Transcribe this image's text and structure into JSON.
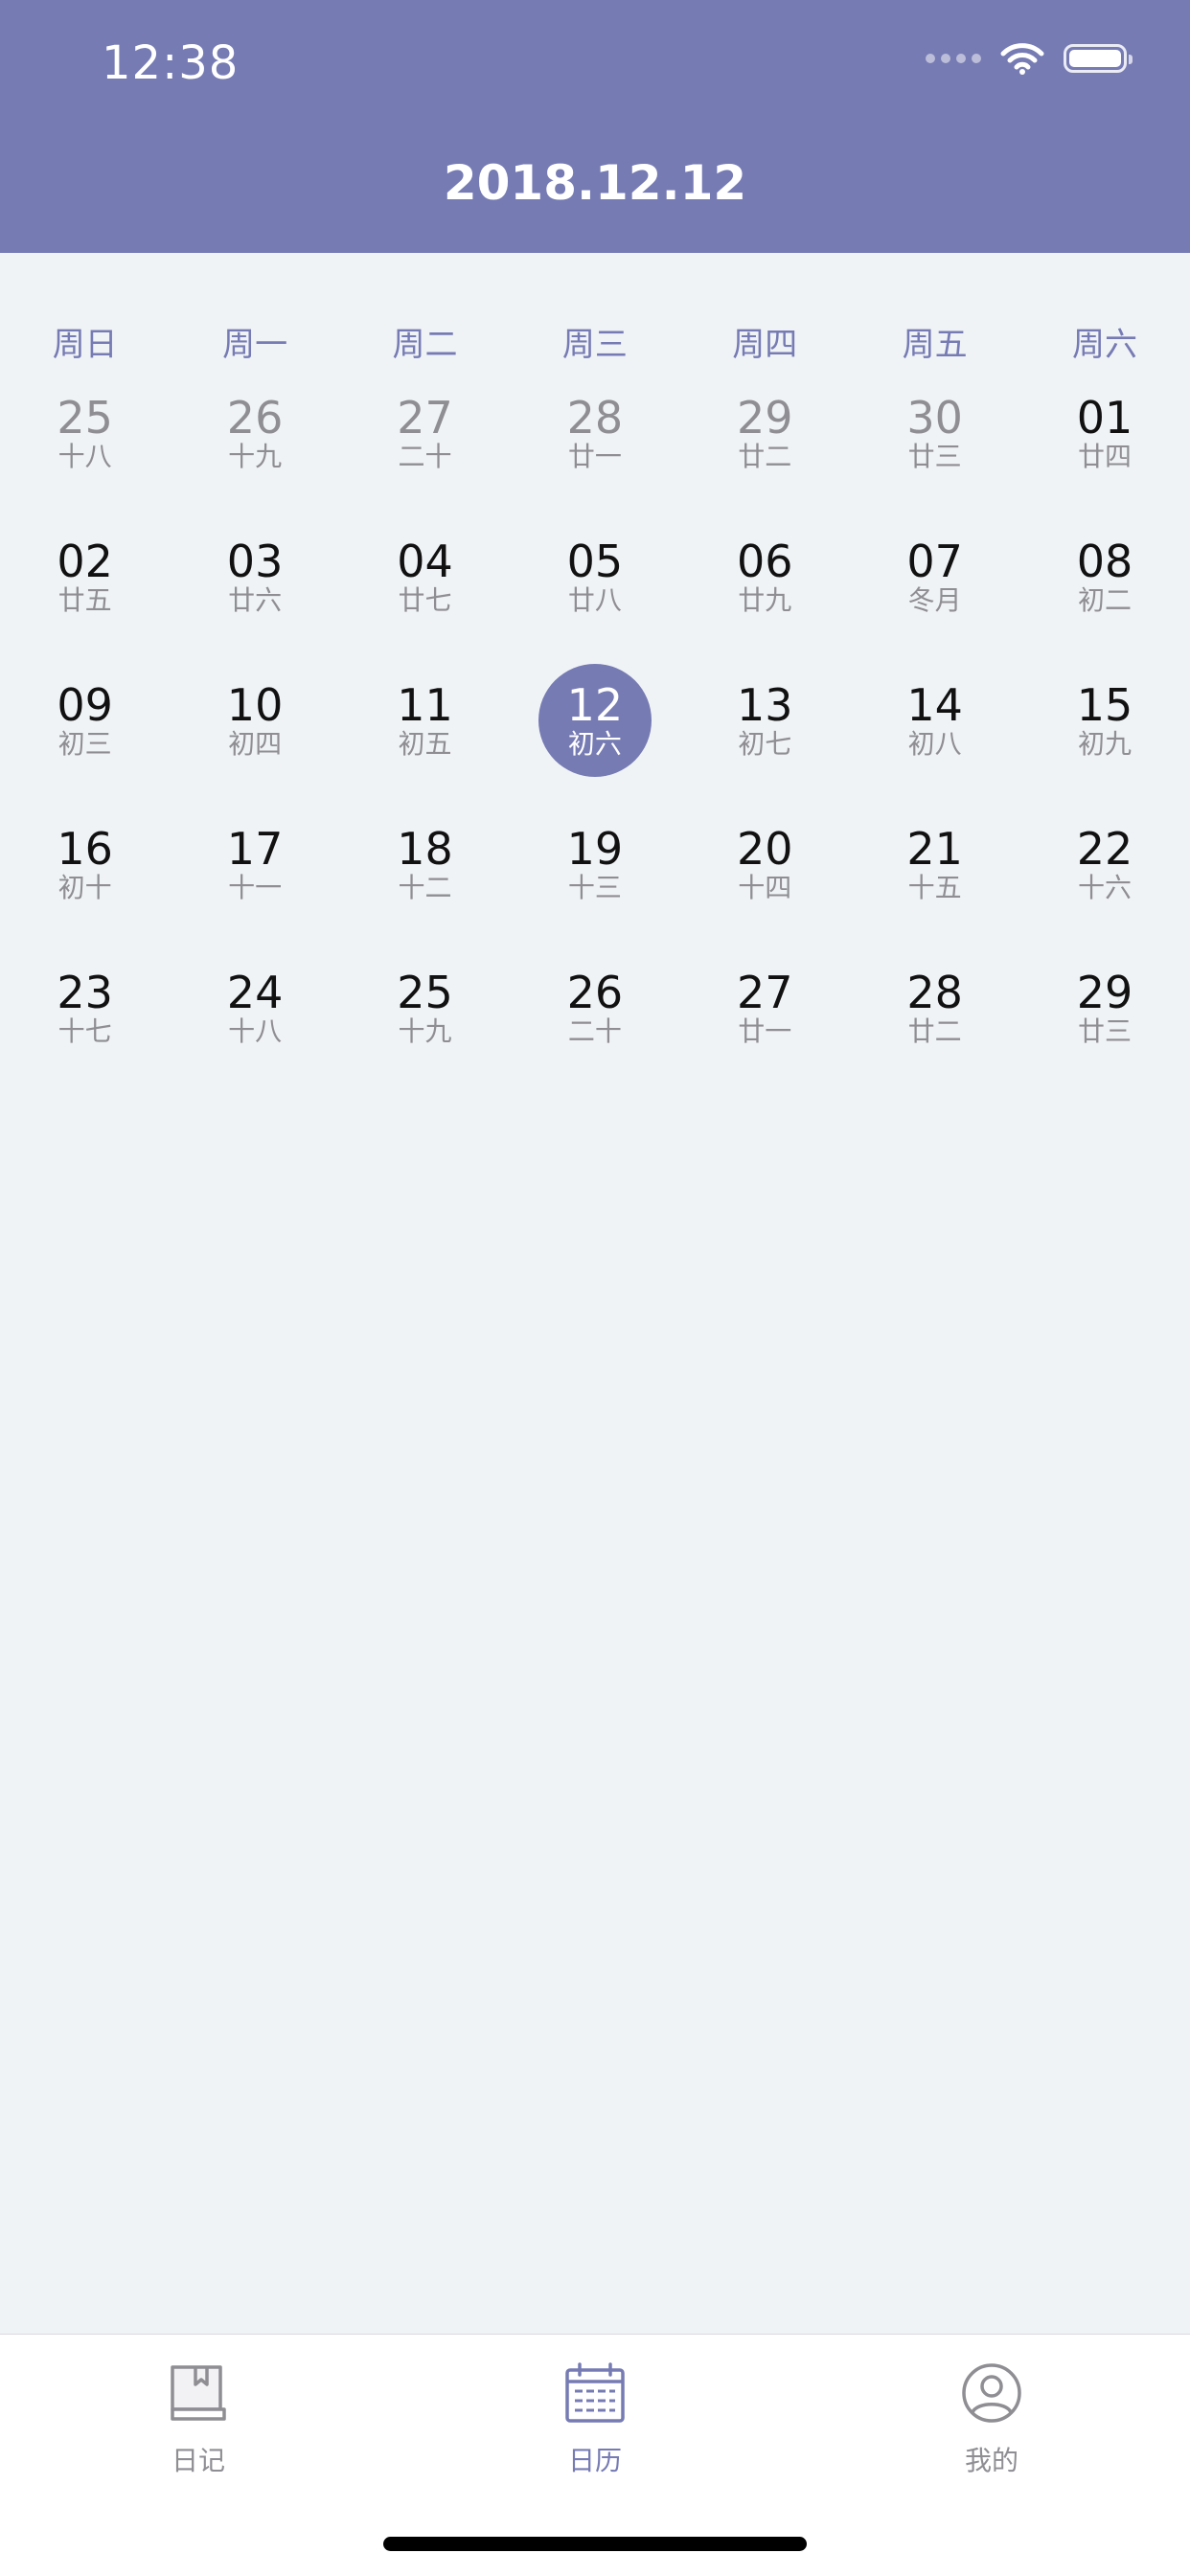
{
  "status_bar": {
    "time": "12:38"
  },
  "header": {
    "title": "2018.12.12"
  },
  "colors": {
    "accent": "#767bb3",
    "background": "#eff3f6",
    "muted_text": "#8e8e93"
  },
  "calendar": {
    "weekdays": [
      "周日",
      "周一",
      "周二",
      "周三",
      "周四",
      "周五",
      "周六"
    ],
    "weeks": [
      [
        {
          "day": "25",
          "lunar": "十八",
          "other_month": true
        },
        {
          "day": "26",
          "lunar": "十九",
          "other_month": true
        },
        {
          "day": "27",
          "lunar": "二十",
          "other_month": true
        },
        {
          "day": "28",
          "lunar": "廿一",
          "other_month": true
        },
        {
          "day": "29",
          "lunar": "廿二",
          "other_month": true
        },
        {
          "day": "30",
          "lunar": "廿三",
          "other_month": true
        },
        {
          "day": "01",
          "lunar": "廿四"
        }
      ],
      [
        {
          "day": "02",
          "lunar": "廿五"
        },
        {
          "day": "03",
          "lunar": "廿六"
        },
        {
          "day": "04",
          "lunar": "廿七"
        },
        {
          "day": "05",
          "lunar": "廿八"
        },
        {
          "day": "06",
          "lunar": "廿九"
        },
        {
          "day": "07",
          "lunar": "冬月"
        },
        {
          "day": "08",
          "lunar": "初二"
        }
      ],
      [
        {
          "day": "09",
          "lunar": "初三"
        },
        {
          "day": "10",
          "lunar": "初四"
        },
        {
          "day": "11",
          "lunar": "初五"
        },
        {
          "day": "12",
          "lunar": "初六",
          "selected": true
        },
        {
          "day": "13",
          "lunar": "初七"
        },
        {
          "day": "14",
          "lunar": "初八"
        },
        {
          "day": "15",
          "lunar": "初九"
        }
      ],
      [
        {
          "day": "16",
          "lunar": "初十"
        },
        {
          "day": "17",
          "lunar": "十一"
        },
        {
          "day": "18",
          "lunar": "十二"
        },
        {
          "day": "19",
          "lunar": "十三"
        },
        {
          "day": "20",
          "lunar": "十四"
        },
        {
          "day": "21",
          "lunar": "十五"
        },
        {
          "day": "22",
          "lunar": "十六"
        }
      ],
      [
        {
          "day": "23",
          "lunar": "十七"
        },
        {
          "day": "24",
          "lunar": "十八"
        },
        {
          "day": "25",
          "lunar": "十九"
        },
        {
          "day": "26",
          "lunar": "二十"
        },
        {
          "day": "27",
          "lunar": "廿一"
        },
        {
          "day": "28",
          "lunar": "廿二"
        },
        {
          "day": "29",
          "lunar": "廿三"
        }
      ]
    ]
  },
  "tabbar": {
    "items": [
      {
        "label": "日记",
        "icon": "diary-book-icon"
      },
      {
        "label": "日历",
        "icon": "calendar-icon",
        "active": true
      },
      {
        "label": "我的",
        "icon": "profile-icon"
      }
    ]
  }
}
